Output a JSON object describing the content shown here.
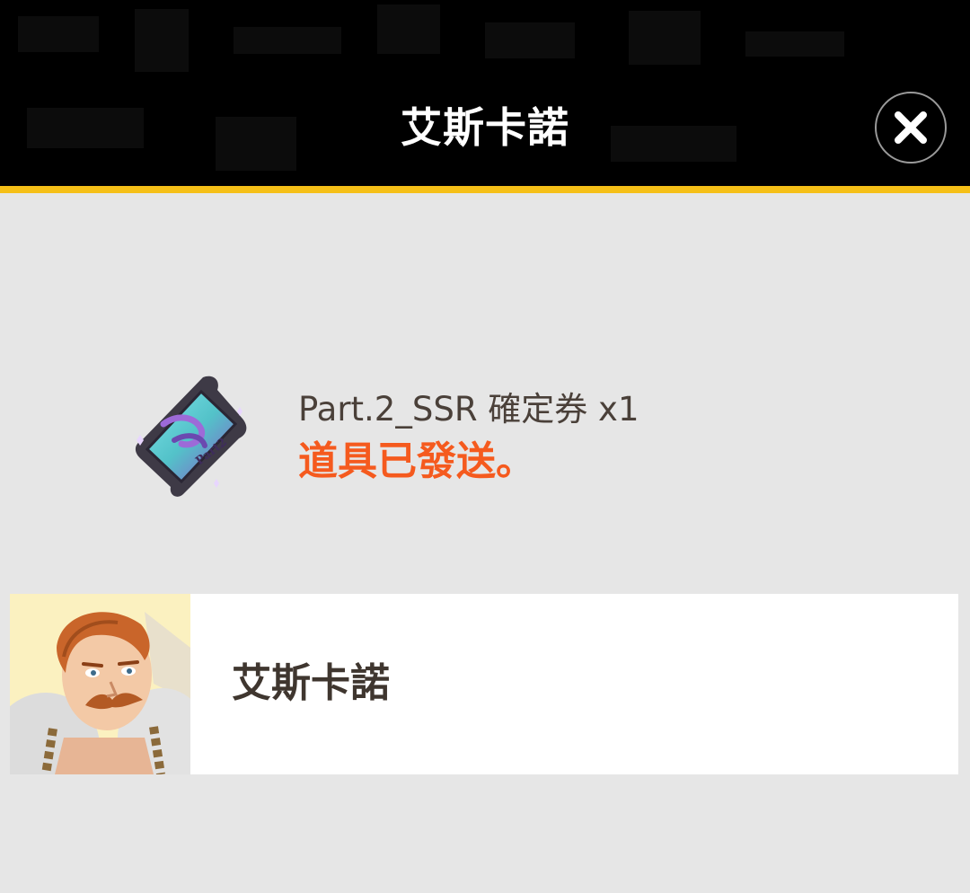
{
  "header": {
    "title": "艾斯卡諾",
    "close_icon": "close-icon"
  },
  "reward": {
    "icon": "ssr-ticket-icon",
    "item_name": "Part.2_SSR 確定券 x1",
    "status": "道具已發送。"
  },
  "character": {
    "portrait": "character-portrait-icon",
    "name": "艾斯卡諾"
  },
  "colors": {
    "header_bg": "#000000",
    "accent_stripe": "#f5bf17",
    "page_bg": "#e6e6e6",
    "status_text": "#f55a1e",
    "body_text": "#4a4039"
  }
}
